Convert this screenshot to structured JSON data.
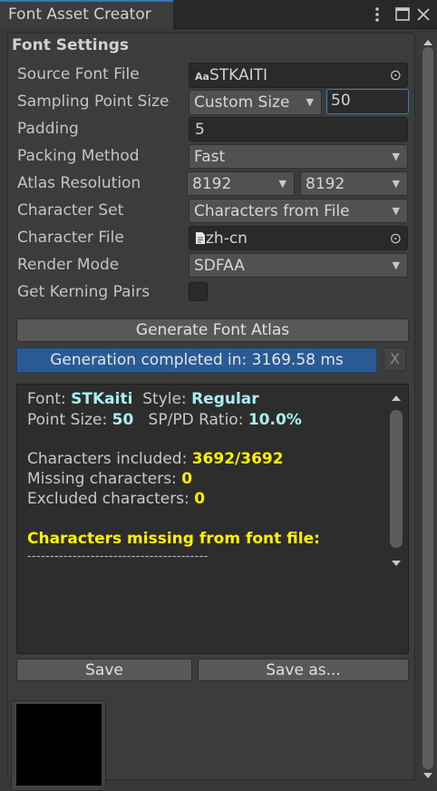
{
  "window": {
    "title": "Font Asset Creator",
    "menu_icon": "kebab-menu-icon",
    "maximize_icon": "maximize-icon",
    "close_icon": "close-icon"
  },
  "section_title": "Font Settings",
  "fields": {
    "source_font_file": {
      "label": "Source Font File",
      "prefix": "Aa",
      "value": "STKAITI"
    },
    "sampling_point_size": {
      "label": "Sampling Point Size",
      "mode": "Custom Size",
      "value": "50"
    },
    "padding": {
      "label": "Padding",
      "value": "5"
    },
    "packing_method": {
      "label": "Packing Method",
      "value": "Fast"
    },
    "atlas_resolution": {
      "label": "Atlas Resolution",
      "width": "8192",
      "height": "8192"
    },
    "character_set": {
      "label": "Character Set",
      "value": "Characters from File"
    },
    "character_file": {
      "label": "Character File",
      "value": "zh-cn"
    },
    "render_mode": {
      "label": "Render Mode",
      "value": "SDFAA"
    },
    "get_kerning_pairs": {
      "label": "Get Kerning Pairs",
      "checked": false
    }
  },
  "buttons": {
    "generate": "Generate Font Atlas",
    "save": "Save",
    "save_as": "Save as...",
    "dismiss": "X"
  },
  "progress": {
    "text": "Generation completed in: 3169.58 ms",
    "fraction": 1.0
  },
  "output": {
    "font_label": "Font:",
    "font_value": "STKaiti",
    "style_label": "Style:",
    "style_value": "Regular",
    "point_size_label": "Point Size:",
    "point_size_value": "50",
    "ratio_label": "SP/PD Ratio:",
    "ratio_value": "10.0%",
    "included_label": "Characters included:",
    "included_value": "3692/3692",
    "missing_label": "Missing characters:",
    "missing_value": "0",
    "excluded_label": "Excluded characters:",
    "excluded_value": "0",
    "missing_header": "Characters missing from font file:",
    "separator": "----------------------------------------"
  },
  "colors": {
    "accent": "#3a72b0",
    "progress": "#2a5a94",
    "highlight_cyan": "#a7f0f5",
    "highlight_yellow": "#fff200"
  }
}
